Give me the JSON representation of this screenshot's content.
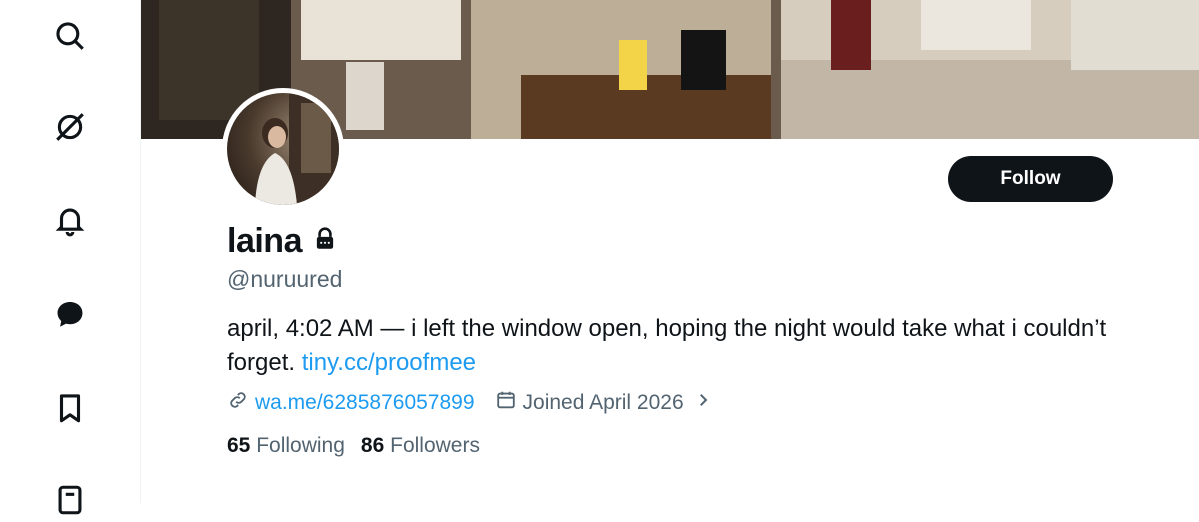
{
  "sidebar": {
    "icons": [
      "search-icon",
      "grok-icon",
      "notifications-icon",
      "messages-icon",
      "bookmarks-icon",
      "lists-icon"
    ]
  },
  "profile": {
    "display_name": "laina",
    "handle": "@nuruured",
    "bio_text": "april, 4:02 AM — i left the window open, hoping the night would take what i couldn’t forget.",
    "bio_link": "tiny.cc/proofmee",
    "website": "wa.me/6285876057899",
    "joined": "Joined April 2026",
    "following_count": "65",
    "following_label": "Following",
    "followers_count": "86",
    "followers_label": "Followers",
    "locked": true
  },
  "actions": {
    "follow_label": "Follow"
  },
  "colors": {
    "text": "#0f1419",
    "secondary": "#536471",
    "link": "#1d9bf0",
    "button_bg": "#0f1419"
  }
}
